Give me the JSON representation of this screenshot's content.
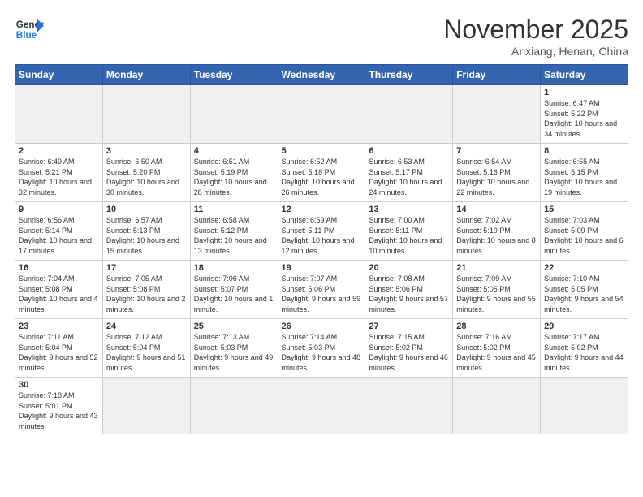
{
  "header": {
    "logo_general": "General",
    "logo_blue": "Blue",
    "month": "November 2025",
    "location": "Anxiang, Henan, China"
  },
  "days_of_week": [
    "Sunday",
    "Monday",
    "Tuesday",
    "Wednesday",
    "Thursday",
    "Friday",
    "Saturday"
  ],
  "weeks": [
    [
      {
        "day": "",
        "info": ""
      },
      {
        "day": "",
        "info": ""
      },
      {
        "day": "",
        "info": ""
      },
      {
        "day": "",
        "info": ""
      },
      {
        "day": "",
        "info": ""
      },
      {
        "day": "",
        "info": ""
      },
      {
        "day": "1",
        "info": "Sunrise: 6:47 AM\nSunset: 5:22 PM\nDaylight: 10 hours\nand 34 minutes."
      }
    ],
    [
      {
        "day": "2",
        "info": "Sunrise: 6:49 AM\nSunset: 5:21 PM\nDaylight: 10 hours\nand 32 minutes."
      },
      {
        "day": "3",
        "info": "Sunrise: 6:50 AM\nSunset: 5:20 PM\nDaylight: 10 hours\nand 30 minutes."
      },
      {
        "day": "4",
        "info": "Sunrise: 6:51 AM\nSunset: 5:19 PM\nDaylight: 10 hours\nand 28 minutes."
      },
      {
        "day": "5",
        "info": "Sunrise: 6:52 AM\nSunset: 5:18 PM\nDaylight: 10 hours\nand 26 minutes."
      },
      {
        "day": "6",
        "info": "Sunrise: 6:53 AM\nSunset: 5:17 PM\nDaylight: 10 hours\nand 24 minutes."
      },
      {
        "day": "7",
        "info": "Sunrise: 6:54 AM\nSunset: 5:16 PM\nDaylight: 10 hours\nand 22 minutes."
      },
      {
        "day": "8",
        "info": "Sunrise: 6:55 AM\nSunset: 5:15 PM\nDaylight: 10 hours\nand 19 minutes."
      }
    ],
    [
      {
        "day": "9",
        "info": "Sunrise: 6:56 AM\nSunset: 5:14 PM\nDaylight: 10 hours\nand 17 minutes."
      },
      {
        "day": "10",
        "info": "Sunrise: 6:57 AM\nSunset: 5:13 PM\nDaylight: 10 hours\nand 15 minutes."
      },
      {
        "day": "11",
        "info": "Sunrise: 6:58 AM\nSunset: 5:12 PM\nDaylight: 10 hours\nand 13 minutes."
      },
      {
        "day": "12",
        "info": "Sunrise: 6:59 AM\nSunset: 5:11 PM\nDaylight: 10 hours\nand 12 minutes."
      },
      {
        "day": "13",
        "info": "Sunrise: 7:00 AM\nSunset: 5:11 PM\nDaylight: 10 hours\nand 10 minutes."
      },
      {
        "day": "14",
        "info": "Sunrise: 7:02 AM\nSunset: 5:10 PM\nDaylight: 10 hours\nand 8 minutes."
      },
      {
        "day": "15",
        "info": "Sunrise: 7:03 AM\nSunset: 5:09 PM\nDaylight: 10 hours\nand 6 minutes."
      }
    ],
    [
      {
        "day": "16",
        "info": "Sunrise: 7:04 AM\nSunset: 5:08 PM\nDaylight: 10 hours\nand 4 minutes."
      },
      {
        "day": "17",
        "info": "Sunrise: 7:05 AM\nSunset: 5:08 PM\nDaylight: 10 hours\nand 2 minutes."
      },
      {
        "day": "18",
        "info": "Sunrise: 7:06 AM\nSunset: 5:07 PM\nDaylight: 10 hours\nand 1 minute."
      },
      {
        "day": "19",
        "info": "Sunrise: 7:07 AM\nSunset: 5:06 PM\nDaylight: 9 hours\nand 59 minutes."
      },
      {
        "day": "20",
        "info": "Sunrise: 7:08 AM\nSunset: 5:06 PM\nDaylight: 9 hours\nand 57 minutes."
      },
      {
        "day": "21",
        "info": "Sunrise: 7:09 AM\nSunset: 5:05 PM\nDaylight: 9 hours\nand 55 minutes."
      },
      {
        "day": "22",
        "info": "Sunrise: 7:10 AM\nSunset: 5:05 PM\nDaylight: 9 hours\nand 54 minutes."
      }
    ],
    [
      {
        "day": "23",
        "info": "Sunrise: 7:11 AM\nSunset: 5:04 PM\nDaylight: 9 hours\nand 52 minutes."
      },
      {
        "day": "24",
        "info": "Sunrise: 7:12 AM\nSunset: 5:04 PM\nDaylight: 9 hours\nand 51 minutes."
      },
      {
        "day": "25",
        "info": "Sunrise: 7:13 AM\nSunset: 5:03 PM\nDaylight: 9 hours\nand 49 minutes."
      },
      {
        "day": "26",
        "info": "Sunrise: 7:14 AM\nSunset: 5:03 PM\nDaylight: 9 hours\nand 48 minutes."
      },
      {
        "day": "27",
        "info": "Sunrise: 7:15 AM\nSunset: 5:02 PM\nDaylight: 9 hours\nand 46 minutes."
      },
      {
        "day": "28",
        "info": "Sunrise: 7:16 AM\nSunset: 5:02 PM\nDaylight: 9 hours\nand 45 minutes."
      },
      {
        "day": "29",
        "info": "Sunrise: 7:17 AM\nSunset: 5:02 PM\nDaylight: 9 hours\nand 44 minutes."
      }
    ],
    [
      {
        "day": "30",
        "info": "Sunrise: 7:18 AM\nSunset: 5:01 PM\nDaylight: 9 hours\nand 43 minutes."
      },
      {
        "day": "",
        "info": ""
      },
      {
        "day": "",
        "info": ""
      },
      {
        "day": "",
        "info": ""
      },
      {
        "day": "",
        "info": ""
      },
      {
        "day": "",
        "info": ""
      },
      {
        "day": "",
        "info": ""
      }
    ]
  ]
}
